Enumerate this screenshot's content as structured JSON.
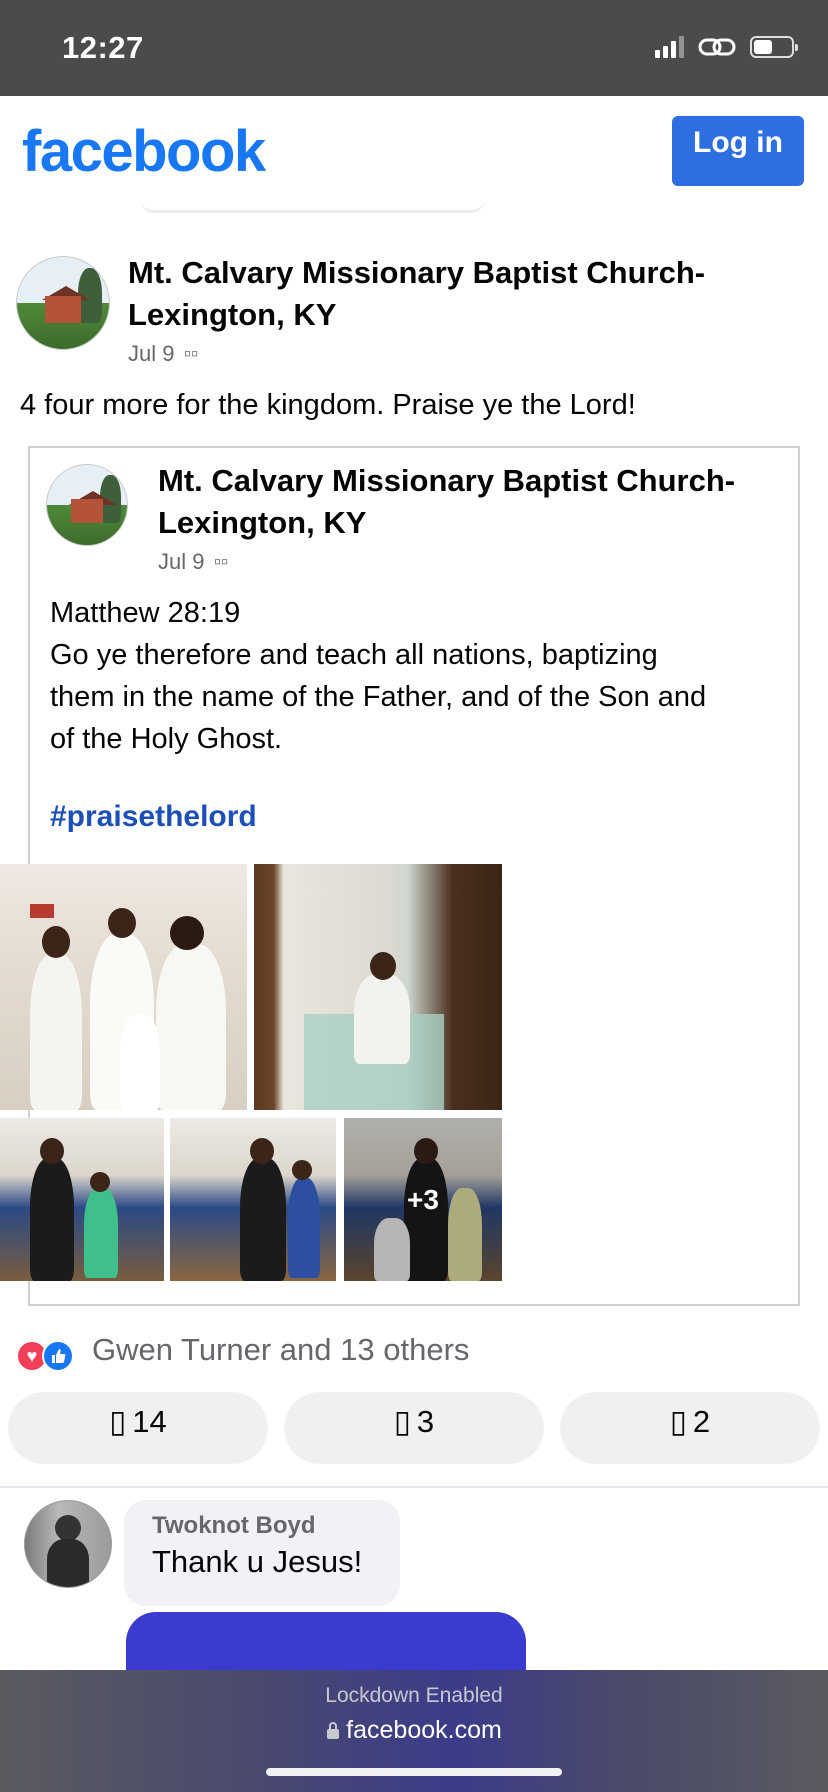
{
  "status_bar": {
    "time": "12:27"
  },
  "header": {
    "logo": "facebook",
    "login_label": "Log in"
  },
  "post": {
    "page_name_line1": "Mt. Calvary Missionary Baptist Church-",
    "page_name_line2": "Lexington, KY",
    "date": "Jul 9",
    "text": "4 four more for the kingdom. Praise ye the Lord!",
    "shared": {
      "page_name_line1": "Mt. Calvary Missionary Baptist Church-",
      "page_name_line2": "Lexington, KY",
      "date": "Jul 9",
      "verse_ref": "Matthew 28:19",
      "verse_line1": "Go ye therefore and teach all nations, baptizing",
      "verse_line2": "them in the name of the Father, and of the Son and",
      "verse_line3": "of the Holy Ghost.",
      "hashtag": "#praisethelord",
      "more_photos": "+3"
    },
    "reactions_text": "Gwen Turner and 13 others",
    "actions": {
      "likes": "14",
      "comments": "3",
      "shares": "2"
    }
  },
  "comment": {
    "author": "Twoknot Boyd",
    "text": "Thank u Jesus!"
  },
  "browser_bar": {
    "lockdown": "Lockdown Enabled",
    "domain": "facebook.com"
  },
  "colors": {
    "brand": "#1877f2",
    "login_button": "#2d6fe0",
    "hashtag": "#1c4fb7",
    "love": "#f33e58"
  },
  "icons": [
    "signal-icon",
    "link-icon",
    "battery-icon",
    "heart-reaction-icon",
    "like-reaction-icon",
    "lock-icon"
  ]
}
